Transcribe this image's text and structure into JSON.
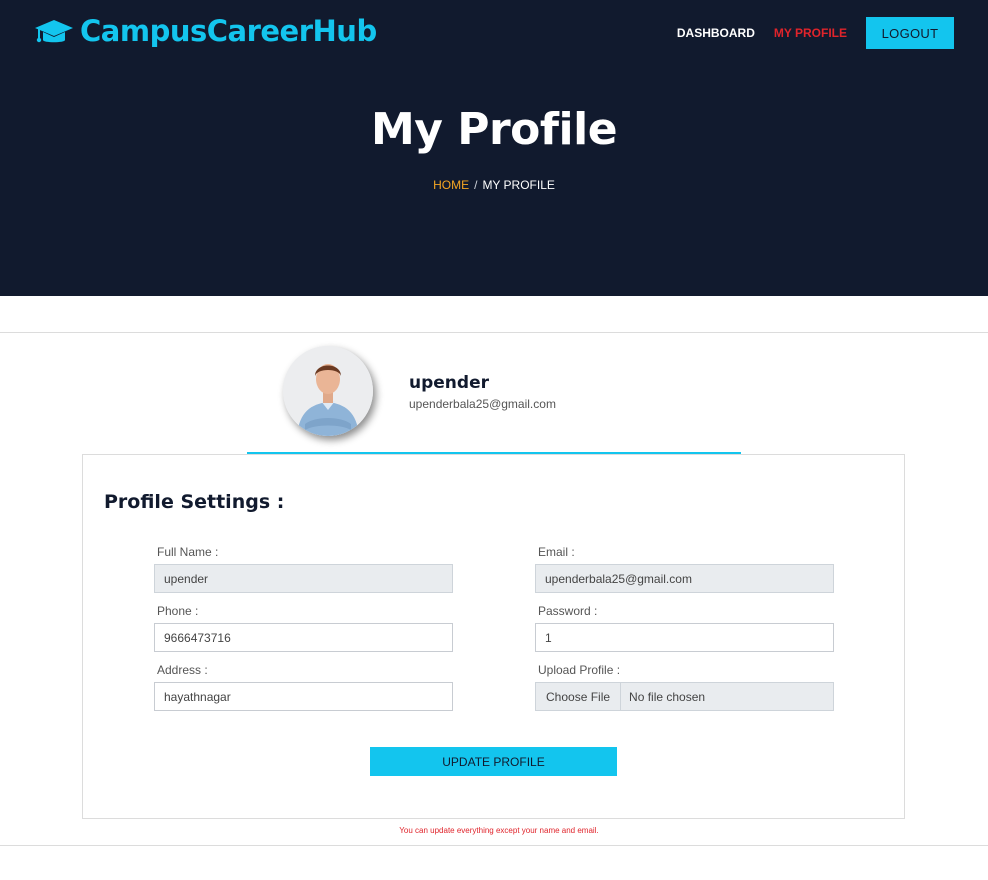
{
  "brand": {
    "name": "CampusCareerHub",
    "icon": "graduation-cap-icon",
    "color": "#13c5ee"
  },
  "nav": {
    "dashboard": "DASHBOARD",
    "my_profile": "MY PROFILE",
    "logout": "LOGOUT",
    "active": "my_profile",
    "active_color": "#e0242b"
  },
  "hero": {
    "title": "My Profile",
    "breadcrumb": {
      "home": "HOME",
      "separator": "/",
      "current": "MY PROFILE"
    },
    "background": "#111a2e"
  },
  "user": {
    "name": "upender",
    "email": "upenderbala25@gmail.com",
    "avatar": "user-avatar-photo"
  },
  "settings": {
    "title": "Profile Settings :",
    "full_name": {
      "label": "Full Name :",
      "value": "upender"
    },
    "email": {
      "label": "Email :",
      "value": "upenderbala25@gmail.com"
    },
    "phone": {
      "label": "Phone :",
      "value": "9666473716"
    },
    "password": {
      "label": "Password :",
      "value": "1"
    },
    "address": {
      "label": "Address :",
      "value": "hayathnagar"
    },
    "upload": {
      "label": "Upload Profile :",
      "button": "Choose File",
      "status": "No file chosen"
    },
    "submit": "UPDATE PROFILE",
    "note": "You can update everything except your name and email."
  }
}
